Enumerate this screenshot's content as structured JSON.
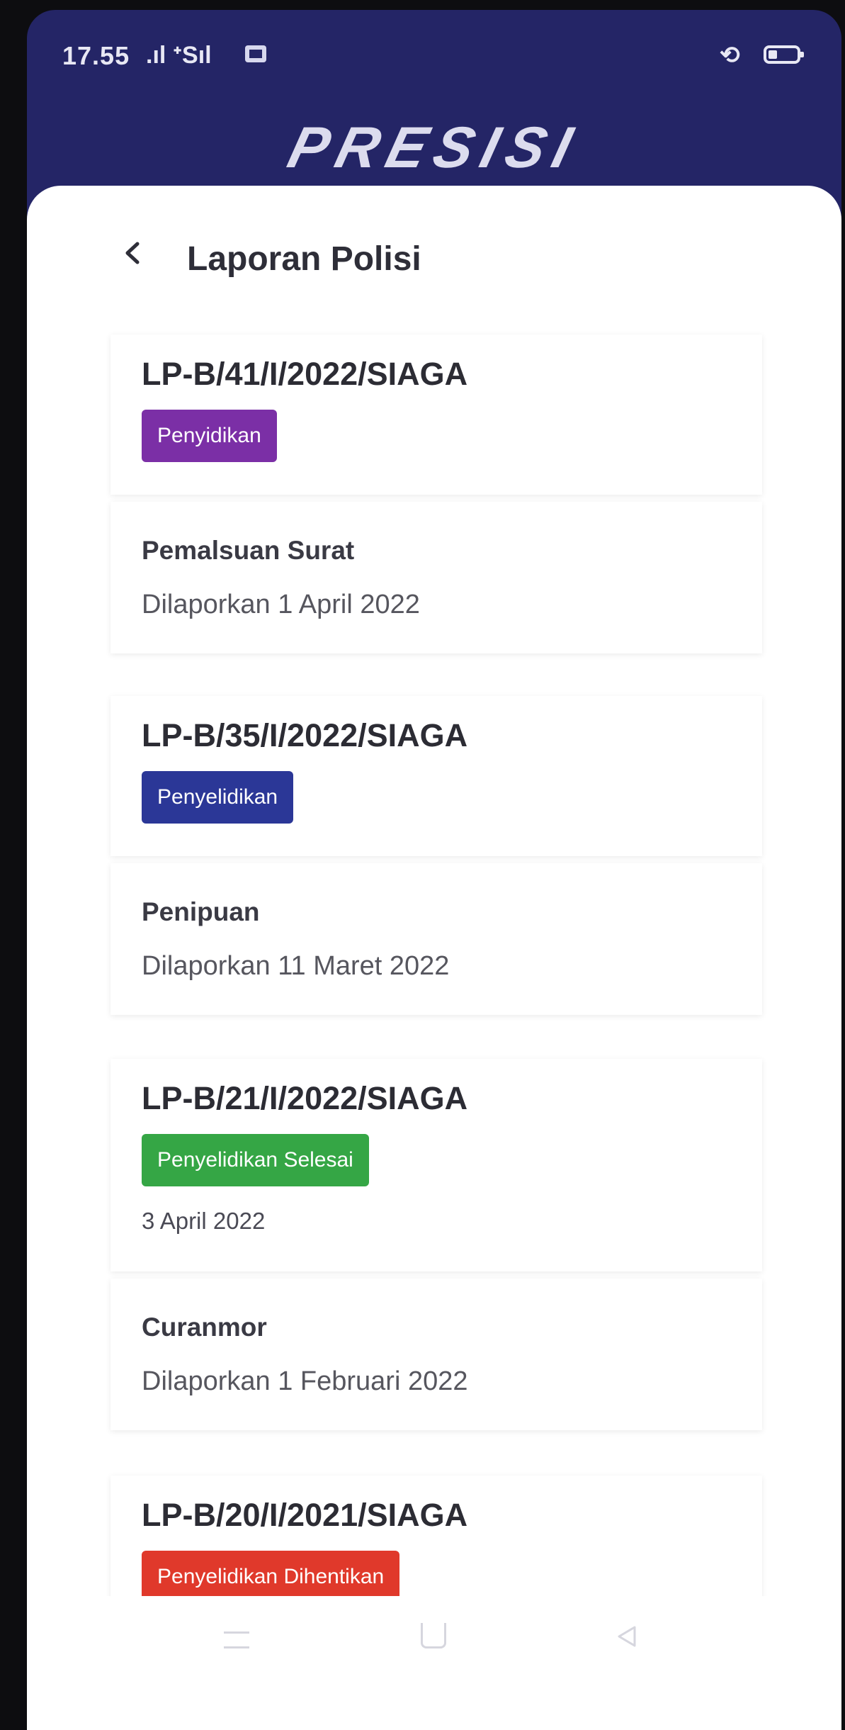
{
  "status_bar": {
    "time": "17.55",
    "signal_text": ".ıl ᐩSıl",
    "rotate_icon": "rotate-lock-icon",
    "battery_icon": "battery-icon"
  },
  "app": {
    "brand": "PRESISI"
  },
  "header": {
    "back_icon": "chevron-left-icon",
    "title": "Laporan Polisi"
  },
  "colors": {
    "header_bg": "#242566",
    "badge_penyidikan": "#7b2fa6",
    "badge_penyelidikan": "#2b3797",
    "badge_selesai": "#35a645",
    "badge_dihentikan": "#e0392b"
  },
  "reports": [
    {
      "number": "LP-B/41/I/2022/SIAGA",
      "status": "Penyidikan",
      "status_date": "",
      "type": "Pemalsuan Surat",
      "reported": "Dilaporkan 1 April 2022"
    },
    {
      "number": "LP-B/35/I/2022/SIAGA",
      "status": "Penyelidikan",
      "status_date": "",
      "type": "Penipuan",
      "reported": "Dilaporkan 11 Maret 2022"
    },
    {
      "number": "LP-B/21/I/2022/SIAGA",
      "status": "Penyelidikan Selesai",
      "status_date": "3 April 2022",
      "type": "Curanmor",
      "reported": "Dilaporkan 1 Februari 2022"
    },
    {
      "number": "LP-B/20/I/2021/SIAGA",
      "status": "Penyelidikan Dihentikan",
      "status_date": "",
      "type": "",
      "reported": ""
    }
  ],
  "nav_bar": {
    "menu_icon": "menu-icon",
    "home_icon": "home-icon",
    "back_icon": "back-triangle-icon"
  }
}
